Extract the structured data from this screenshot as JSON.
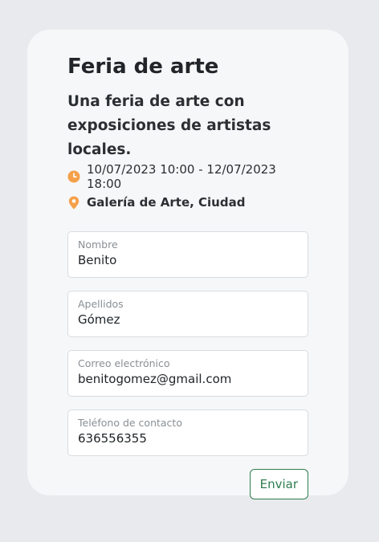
{
  "event": {
    "title": "Feria de arte",
    "description": "Una feria de arte con exposiciones de artistas locales.",
    "datetime": "10/07/2023 10:00 - 12/07/2023 18:00",
    "location": "Galería de Arte, Ciudad",
    "icons": {
      "time": "clock-icon",
      "location": "map-pin-icon"
    },
    "accent_color": "#f5a04a"
  },
  "form": {
    "fields": [
      {
        "label": "Nombre",
        "value": "Benito"
      },
      {
        "label": "Apellidos",
        "value": "Gómez"
      },
      {
        "label": "Correo electrónico",
        "value": "benitogomez@gmail.com"
      },
      {
        "label": "Teléfono de contacto",
        "value": "636556355"
      }
    ],
    "submit_label": "Enviar",
    "submit_color": "#2e7d4f"
  }
}
